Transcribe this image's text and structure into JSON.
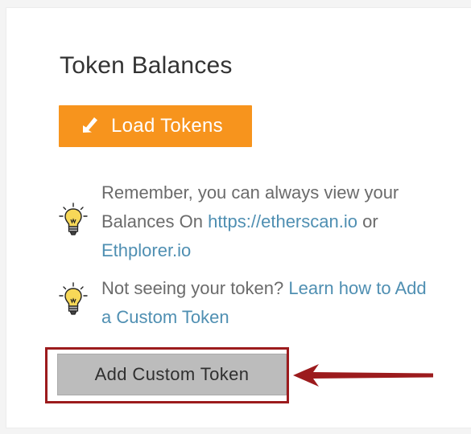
{
  "panel": {
    "title": "Token Balances",
    "load_tokens": {
      "label": "Load Tokens",
      "icon": "download-arrow-icon",
      "color": "#f7941d"
    },
    "tips": [
      {
        "icon": "lightbulb-icon",
        "text_1": "Remember, you can always view your Balances On ",
        "link_1": "https://etherscan.io",
        "text_2": " or ",
        "link_2": "Ethplorer.io"
      },
      {
        "icon": "lightbulb-icon",
        "text_1": "Not seeing your token? ",
        "link_1": "Learn how to Add a Custom Token"
      }
    ],
    "add_custom_token": {
      "label": "Add Custom Token"
    }
  },
  "annotation": {
    "highlight_color": "#9c1b1d",
    "arrow_icon": "left-pointing-arrow-icon"
  },
  "colors": {
    "link": "#4f8fb2",
    "body_text": "#6b6b6b",
    "title_text": "#333333",
    "button_gray": "#bcbcbc"
  }
}
